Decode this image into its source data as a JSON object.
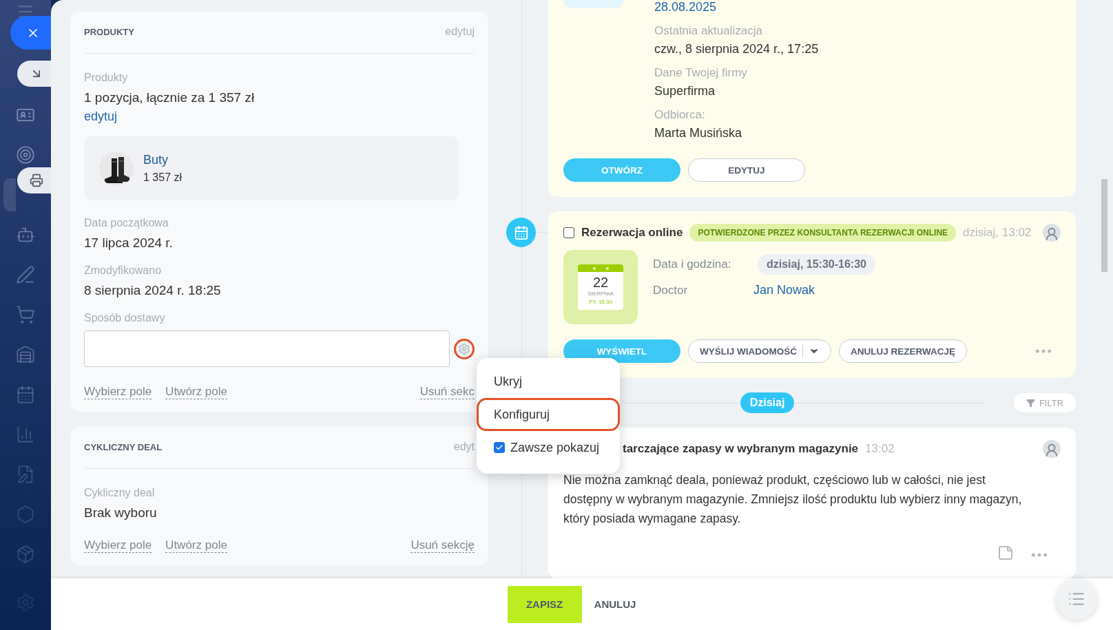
{
  "left_sections": [
    {
      "title": "PRODUKTY",
      "edit_link": "edytuj",
      "fields": [
        {
          "kind": "products",
          "label": "Produkty",
          "value": "1 pozycja, łącznie za 1 357 zł",
          "link": "edytuj",
          "product": {
            "name": "Buty",
            "price": "1 357 zł"
          }
        },
        {
          "kind": "text",
          "label": "Data początkowa",
          "value": "17 lipca 2024 r."
        },
        {
          "kind": "text",
          "label": "Zmodyfikowano",
          "value": "8 sierpnia 2024 r. 18:25"
        },
        {
          "kind": "input",
          "label": "Sposób dostawy",
          "gear_highlighted": true
        }
      ],
      "footer": {
        "left_links": [
          "Wybierz pole",
          "Utwórz pole"
        ],
        "right_link": "Usuń sekc"
      }
    },
    {
      "title": "CYKLICZNY DEAL",
      "edit_link": "edyt",
      "fields": [
        {
          "kind": "text",
          "label": "Cykliczny deal",
          "value": "Brak wyboru"
        }
      ],
      "footer": {
        "left_links": [
          "Wybierz pole",
          "Utwórz pole"
        ],
        "right_link": "Usuń sekcję"
      }
    }
  ],
  "context_menu": {
    "items": [
      {
        "kind": "action",
        "label": "Ukryj",
        "highlighted": false
      },
      {
        "kind": "action",
        "label": "Konfiguruj",
        "highlighted": true
      },
      {
        "kind": "check",
        "label": "Zawsze pokazuj",
        "checked": true,
        "highlighted": false
      }
    ]
  },
  "document_card": {
    "rows": [
      {
        "kind": "link",
        "value": "28.08.2025"
      },
      {
        "kind": "text",
        "label": "Ostatnia aktualizacja",
        "value": "czw., 8 sierpnia 2024 r., 17:25"
      },
      {
        "kind": "text",
        "label": "Dane Twojej firmy",
        "value": "Superfirma"
      },
      {
        "kind": "text",
        "label": "Odbiorca:",
        "value": "Marta Musińska"
      }
    ],
    "buttons": [
      {
        "kind": "primary",
        "label": "OTWÓRZ"
      },
      {
        "kind": "outline",
        "label": "EDYTUJ"
      }
    ]
  },
  "booking_card": {
    "checked": false,
    "title": "Rezerwacja online",
    "badge": "POTWIERDZONE PRZEZ KONSULTANTA REZERWACJI ONLINE",
    "time": "dzisiaj, 13:02",
    "calendar": {
      "day": "22",
      "month": "SIERPNIA",
      "time": "PT. 15:30"
    },
    "details": [
      {
        "kind": "pill",
        "label": "Data i godzina:",
        "value": "dzisiaj, 15:30-16:30"
      },
      {
        "kind": "link",
        "label": "Doctor",
        "value": "Jan Nowak"
      }
    ],
    "buttons": [
      {
        "kind": "primary",
        "label": "WYŚWIETL"
      },
      {
        "kind": "split",
        "label": "WYŚLIJ WIADOMOŚĆ"
      },
      {
        "kind": "outline",
        "label": "ANULUJ REZERWACJĘ"
      }
    ]
  },
  "timeline_divider": {
    "label": "Dzisiaj",
    "filter": "FILTR"
  },
  "warning_card": {
    "title": "tarczające zapasy w wybranym magazynie",
    "time": "13:02",
    "text": "Nie można zamknąć deala, ponieważ produkt, częściowo lub w całości, nie jest dostępny w wybranym magazynie. Zmniejsz ilość produktu lub wybierz inny magazyn, który posiada wymagane zapasy."
  },
  "footer": {
    "buttons": [
      {
        "kind": "primary",
        "label": "ZAPISZ"
      },
      {
        "kind": "plain",
        "label": "ANULUJ"
      }
    ]
  }
}
